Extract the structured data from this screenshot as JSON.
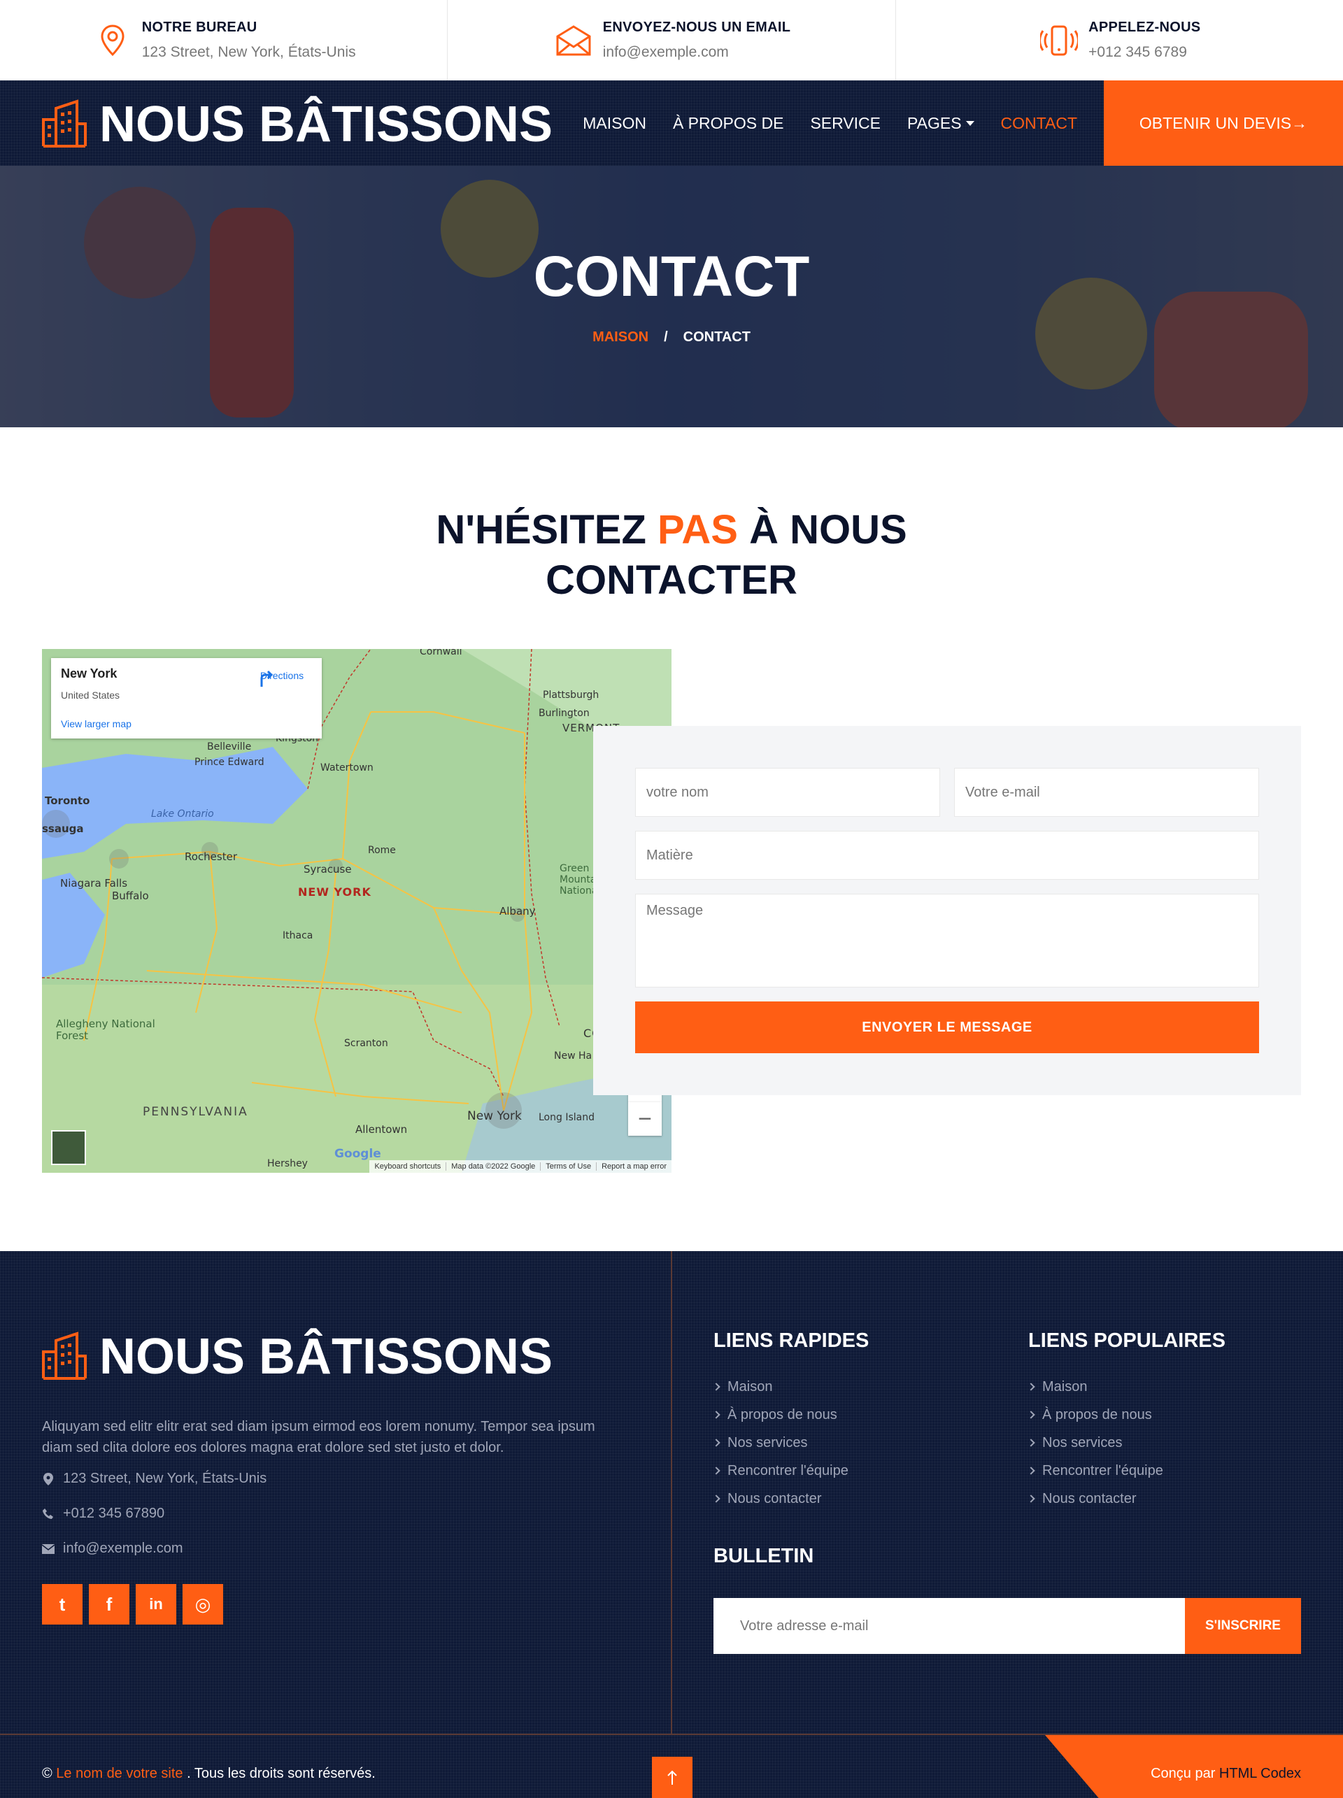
{
  "topbar": {
    "office": {
      "title": "NOTRE BUREAU",
      "value": "123 Street, New York, États-Unis",
      "icon": "map-pin-icon"
    },
    "email": {
      "title": "ENVOYEZ-NOUS UN EMAIL",
      "value": "info@exemple.com",
      "icon": "envelope-icon"
    },
    "phone": {
      "title": "APPELEZ-NOUS",
      "value": "+012 345 6789",
      "icon": "phone-ringing-icon"
    }
  },
  "brand": {
    "name": "NOUS BÂTISSONS",
    "icon": "building-icon"
  },
  "nav": {
    "items": [
      {
        "label": "MAISON"
      },
      {
        "label": "À PROPOS DE"
      },
      {
        "label": "SERVICE"
      },
      {
        "label": "PAGES"
      },
      {
        "label": "CONTACT"
      }
    ],
    "quote_button": "OBTENIR UN DEVIS→"
  },
  "hero": {
    "title": "CONTACT",
    "breadcrumb": {
      "home": "MAISON",
      "sep": "/",
      "current": "CONTACT"
    }
  },
  "section": {
    "title_part1": "N'HÉSITEZ ",
    "title_highlight": "PAS",
    "title_part2": " À NOUS CONTACTER"
  },
  "map": {
    "card_title": "New York",
    "card_subtitle": "United States",
    "card_link": "View larger map",
    "directions": "Directions",
    "labels": {
      "toronto": "Toronto",
      "ssauga": "ssauga",
      "lake": "Lake Ontario",
      "belleville": "Belleville",
      "prince_edward": "Prince Edward",
      "kingston": "Kingston",
      "watertown": "Watertown",
      "rochester": "Rochester",
      "syracuse": "Syracuse",
      "rome": "Rome",
      "state": "NEW YORK",
      "niagara": "Niagara Falls",
      "buffalo": "Buffalo",
      "albany": "Albany",
      "ithaca": "Ithaca",
      "plattsburgh": "Plattsburgh",
      "burlington": "Burlington",
      "cornwall": "Cornwall",
      "allegheny": "Allegheny National Forest",
      "scranton": "Scranton",
      "pennsylvania": "PENNSYLVANIA",
      "allentown": "Allentown",
      "nyc": "New York",
      "long_island": "Long Island",
      "hershey": "Hershey",
      "conn": "CONN",
      "new_haven": "New Ha",
      "green_mountain": "Green Mounta National Fo",
      "vermont": "VERMONT"
    },
    "zoom_in": "+",
    "zoom_out": "−",
    "google": "Google",
    "attribution": [
      "Keyboard shortcuts",
      "Map data ©2022 Google",
      "Terms of Use",
      "Report a map error"
    ]
  },
  "form": {
    "name_placeholder": "votre nom",
    "email_placeholder": "Votre e-mail",
    "subject_placeholder": "Matière",
    "message_placeholder": "Message",
    "submit": "ENVOYER LE MESSAGE"
  },
  "footer": {
    "brand": "NOUS BÂTISSONS",
    "about": "Aliquyam sed elitr elitr erat sed diam ipsum eirmod eos lorem nonumy. Tempor sea ipsum diam sed clita dolore eos dolores magna erat dolore sed stet justo et dolor.",
    "address": "123 Street, New York, États-Unis",
    "phone": "+012 345 67890",
    "email": "info@exemple.com",
    "social": [
      {
        "name": "twitter-icon",
        "glyph": "t"
      },
      {
        "name": "facebook-icon",
        "glyph": "f"
      },
      {
        "name": "linkedin-icon",
        "glyph": "in"
      },
      {
        "name": "instagram-icon",
        "glyph": "◎"
      }
    ],
    "quick_links": {
      "title": "LIENS RAPIDES",
      "items": [
        "Maison",
        "À propos de nous",
        "Nos services",
        "Rencontrer l'équipe",
        "Nous contacter"
      ]
    },
    "popular_links": {
      "title": "LIENS POPULAIRES",
      "items": [
        "Maison",
        "À propos de nous",
        "Nos services",
        "Rencontrer l'équipe",
        "Nous contacter"
      ]
    },
    "newsletter": {
      "title": "BULLETIN",
      "placeholder": "Votre adresse e-mail",
      "button": "S'INSCRIRE"
    },
    "copyright": {
      "prefix": "© ",
      "site_link": "Le nom de votre site",
      "suffix": " . Tous les droits sont réservés."
    },
    "credit": {
      "prefix": "Conçu par ",
      "link": "HTML Codex"
    }
  },
  "colors": {
    "accent": "#ff5e14",
    "dark": "#0f1a37",
    "heading": "#0b132b"
  }
}
